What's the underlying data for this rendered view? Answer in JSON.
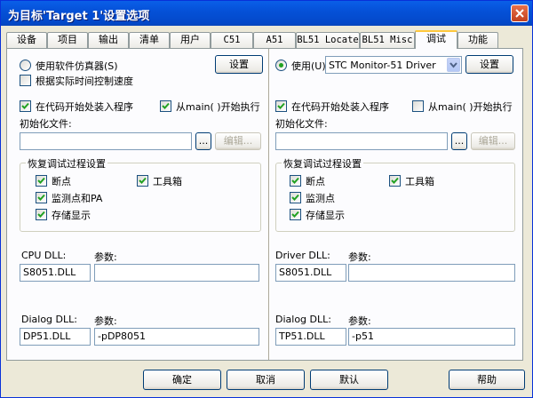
{
  "window": {
    "title": "为目标'Target 1'设置选项"
  },
  "tabs": [
    {
      "label": "设备"
    },
    {
      "label": "项目"
    },
    {
      "label": "输出"
    },
    {
      "label": "清单"
    },
    {
      "label": "用户"
    },
    {
      "label": "C51"
    },
    {
      "label": "A51"
    },
    {
      "label": "BL51 Locate"
    },
    {
      "label": "BL51 Misc"
    },
    {
      "label": "调试"
    },
    {
      "label": "功能"
    }
  ],
  "left": {
    "use_simulator": "使用软件仿真器(S)",
    "limit_speed": "根据实际时间控制速度",
    "settings": "设置",
    "load_app": "在代码开始处装入程序",
    "run_main": "从main( )开始执行",
    "init_file_label": "初始化文件:",
    "browse": "...",
    "edit": "编辑...",
    "restore_group": "恢复调试过程设置",
    "breakpoints": "断点",
    "toolbox": "工具箱",
    "watch": "监测点和PA",
    "memory": "存储显示",
    "cpu_dll_label": "CPU DLL:",
    "cpu_param_label": "参数:",
    "cpu_dll_value": "S8051.DLL",
    "cpu_param_value": "",
    "dialog_dll_label": "Dialog DLL:",
    "dialog_param_label": "参数:",
    "dialog_dll_value": "DP51.DLL",
    "dialog_param_value": "-pDP8051"
  },
  "right": {
    "use_label": "使用(U):",
    "driver_value": "STC Monitor-51 Driver",
    "settings": "设置",
    "load_app": "在代码开始处装入程序",
    "run_main": "从main( )开始执行",
    "init_file_label": "初始化文件:",
    "browse": "...",
    "edit": "编辑...",
    "restore_group": "恢复调试过程设置",
    "breakpoints": "断点",
    "toolbox": "工具箱",
    "watch": "监测点",
    "memory": "存储显示",
    "driver_dll_label": "Driver DLL:",
    "driver_param_label": "参数:",
    "driver_dll_value": "S8051.DLL",
    "driver_param_value": "",
    "dialog_dll_label": "Dialog DLL:",
    "dialog_param_label": "参数:",
    "dialog_dll_value": "TP51.DLL",
    "dialog_param_value": "-p51"
  },
  "footer": {
    "ok": "确定",
    "cancel": "取消",
    "defaults": "默认",
    "help": "帮助"
  }
}
